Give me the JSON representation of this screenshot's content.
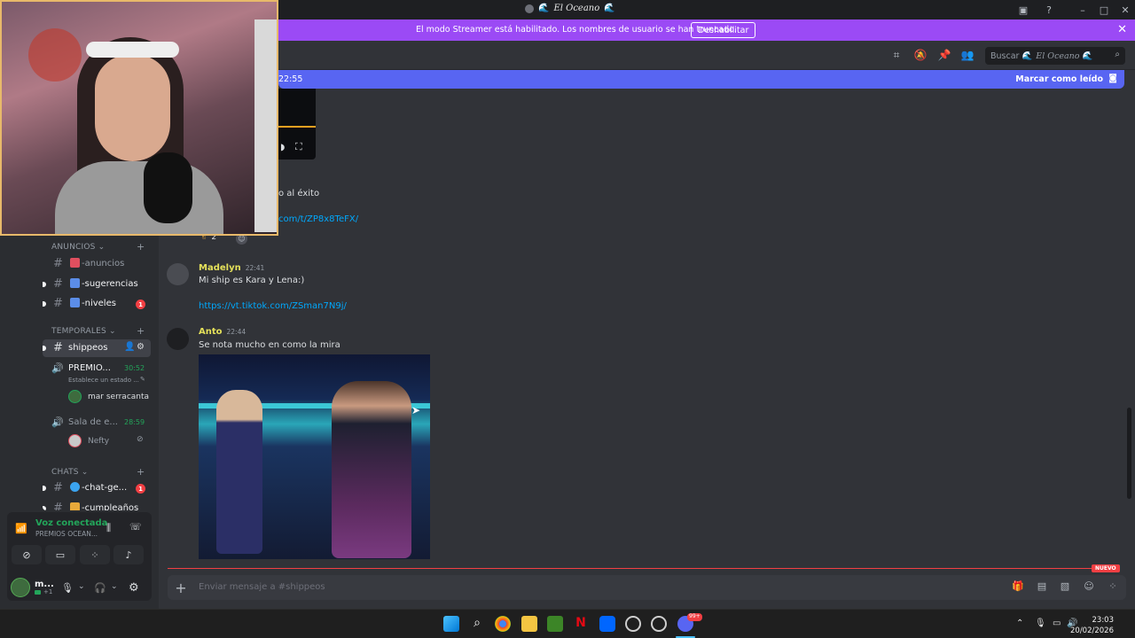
{
  "window": {
    "title": "El Oceano",
    "title_wave": "🌊"
  },
  "banner": {
    "text": "El modo Streamer está habilitado. Los nombres de usuario se han truncado.",
    "button": "Deshabilitar"
  },
  "header": {
    "search_label": "Buscar",
    "search_server": "El Oceano",
    "search_wave": "🌊"
  },
  "new_messages_bar": {
    "time": "22:55",
    "mark_read": "Marcar como leído"
  },
  "sidebar": {
    "categories": {
      "anuncios": "ANUNCIOS",
      "temporales": "TEMPORALES",
      "chats": "CHATS"
    },
    "channels": [
      {
        "label": "-anuncios",
        "emoji_color": "#e04f5f"
      },
      {
        "label": "-sugerencias",
        "emoji_color": "#5b8de8"
      },
      {
        "label": "-niveles",
        "emoji_color": "#5b8de8",
        "badge": "1"
      },
      {
        "label": "shippeos"
      },
      {
        "label": "-chat-ge...",
        "emoji_color": "#3ba4f0",
        "badge": "1"
      },
      {
        "label": "-cumpleaños",
        "emoji_color": "#e8a93a"
      }
    ],
    "voice_channels": [
      {
        "name": "PREMIO...",
        "timer": "30:52",
        "status": "Establece un estado ...",
        "member": "mar serracanta"
      },
      {
        "name": "Sala de e...",
        "timer": "28:59",
        "member": "Nefty"
      }
    ]
  },
  "voice_panel": {
    "status": "Voz conectada",
    "channel": "PREMIOS OCEAN..."
  },
  "user_panel": {
    "name": "m...",
    "sub": "+1"
  },
  "messages": {
    "partial_text": "o al éxito",
    "partial_link": "com/t/ZP8x8TeFX/",
    "reaction_count": "2",
    "madelyn": {
      "author": "Madelyn",
      "time": "22:41",
      "text": "Mi ship es Kara y Lena:)",
      "link": "https://vt.tiktok.com/ZSman7N9j/",
      "color": "#e4e05a"
    },
    "anto": {
      "author": "Anto",
      "time": "22:44",
      "text": "Se nota mucho en como la mira",
      "color": "#e4e05a"
    }
  },
  "divider": {
    "label": "NUEVO"
  },
  "composer": {
    "placeholder": "Enviar mensaje a #shippeos"
  },
  "taskbar": {
    "time": "23:03",
    "date": "20/02/2026",
    "discord_badge": "99+"
  }
}
